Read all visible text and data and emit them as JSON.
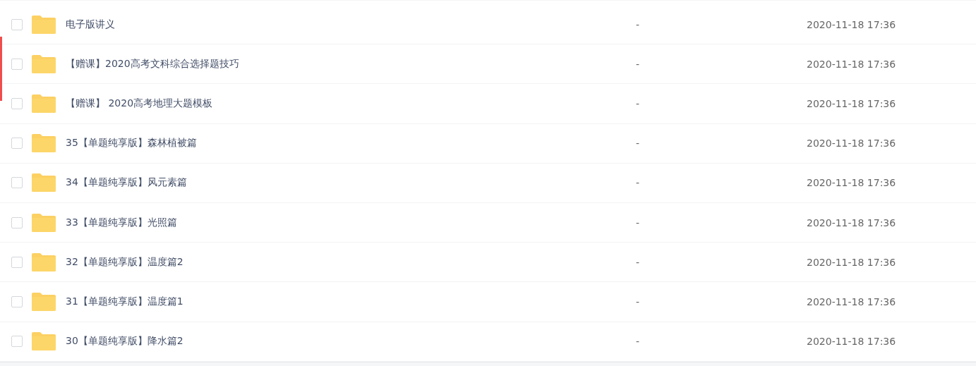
{
  "rows": [
    {
      "name": "电子版讲义",
      "size": "-",
      "modified": "2020-11-18 17:36",
      "checked": false
    },
    {
      "name": "【赠课】2020高考文科综合选择题技巧",
      "size": "-",
      "modified": "2020-11-18 17:36",
      "checked": false
    },
    {
      "name": "【赠课】 2020高考地理大题模板",
      "size": "-",
      "modified": "2020-11-18 17:36",
      "checked": false
    },
    {
      "name": "35【单题纯享版】森林植被篇",
      "size": "-",
      "modified": "2020-11-18 17:36",
      "checked": false
    },
    {
      "name": "34【单题纯享版】风元素篇",
      "size": "-",
      "modified": "2020-11-18 17:36",
      "checked": false
    },
    {
      "name": "33【单题纯享版】光照篇",
      "size": "-",
      "modified": "2020-11-18 17:36",
      "checked": false
    },
    {
      "name": "32【单题纯享版】温度篇2",
      "size": "-",
      "modified": "2020-11-18 17:36",
      "checked": false
    },
    {
      "name": "31【单题纯享版】温度篇1",
      "size": "-",
      "modified": "2020-11-18 17:36",
      "checked": false
    },
    {
      "name": "30【单题纯享版】降水篇2",
      "size": "-",
      "modified": "2020-11-18 17:36",
      "checked": false
    }
  ]
}
